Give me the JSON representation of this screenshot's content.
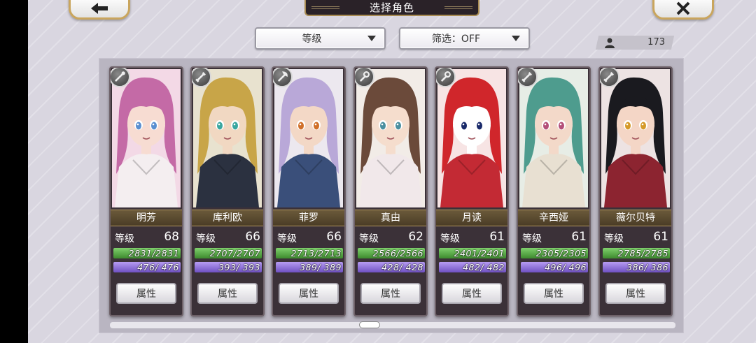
{
  "header": {
    "title": "选择角色"
  },
  "controls": {
    "sort": {
      "label": "等级"
    },
    "filter": {
      "label": "筛选：OFF"
    },
    "count": "173"
  },
  "colors": {
    "hp_bar": "#4fa63d",
    "mp_bar": "#8a6ed8",
    "name_plate": "#5b4b30"
  },
  "characters": [
    {
      "name": "明芳",
      "level_label": "等级",
      "level": "68",
      "hp": "2831/2831",
      "mp": "476/ 476",
      "attr_label": "属性",
      "weapon": "staff-icon"
    },
    {
      "name": "库利欧",
      "level_label": "等级",
      "level": "66",
      "hp": "2707/2707",
      "mp": "393/ 393",
      "attr_label": "属性",
      "weapon": "sword-icon"
    },
    {
      "name": "菲罗",
      "level_label": "等级",
      "level": "66",
      "hp": "2713/2713",
      "mp": "389/ 389",
      "attr_label": "属性",
      "weapon": "axe-icon"
    },
    {
      "name": "真由",
      "level_label": "等级",
      "level": "62",
      "hp": "2566/2566",
      "mp": "428/ 428",
      "attr_label": "属性",
      "weapon": "rod-icon"
    },
    {
      "name": "月读",
      "level_label": "等级",
      "level": "61",
      "hp": "2401/2401",
      "mp": "482/ 482",
      "attr_label": "属性",
      "weapon": "rod-icon"
    },
    {
      "name": "辛西娅",
      "level_label": "等级",
      "level": "61",
      "hp": "2305/2305",
      "mp": "496/ 496",
      "attr_label": "属性",
      "weapon": "sword-icon"
    },
    {
      "name": "薇尔贝特",
      "level_label": "等级",
      "level": "61",
      "hp": "2785/2785",
      "mp": "386/ 386",
      "attr_label": "属性",
      "weapon": "sword-icon"
    }
  ]
}
